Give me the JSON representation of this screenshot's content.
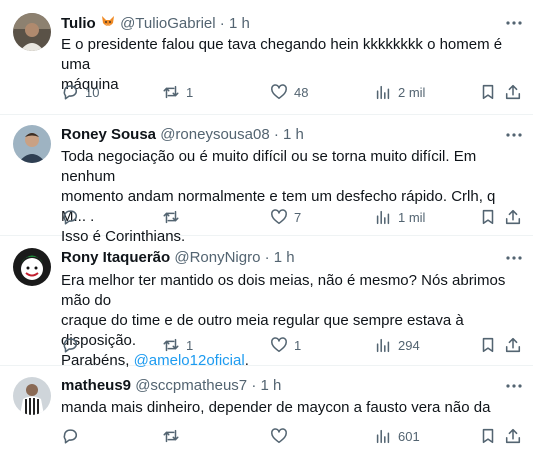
{
  "colors": {
    "text": "#0f1419",
    "secondary": "#536471",
    "accent": "#1d9bf0",
    "divider": "#eff3f4"
  },
  "tweets": [
    {
      "name": "Tulio",
      "handle": "@TulioGabriel",
      "time": "1 h",
      "text_lines": [
        "E o presidente falou que tava chegando hein kkkkkkkk o homem é uma",
        "máquina"
      ],
      "replies": "10",
      "reposts": "1",
      "likes": "48",
      "views": "2 mil"
    },
    {
      "name": "Roney Sousa",
      "handle": "@roneysousa08",
      "time": "1 h",
      "text_lines": [
        "Toda negociação ou é muito difícil ou se torna muito difícil. Em nenhum",
        "momento andam normalmente e tem um desfecho rápido. Crlh, q M... .",
        "Isso é Corinthians."
      ],
      "replies": "",
      "reposts": "",
      "likes": "7",
      "views": "1 mil"
    },
    {
      "name": "Rony Itaquerão",
      "handle": "@RonyNigro",
      "time": "1 h",
      "text_lines": [
        "Era melhor ter mantido os dois meias, não é mesmo? Nós abrimos mão do",
        "craque do time e de outro meia regular que sempre estava à disposição.",
        "Parabéns,"
      ],
      "mention": "@amelo12oficial",
      "mention_suffix": ".",
      "replies": "",
      "reposts": "1",
      "likes": "1",
      "views": "294"
    },
    {
      "name": "matheus9",
      "handle": "@sccpmatheus7",
      "time": "1 h",
      "text_lines": [
        "manda mais dinheiro, depender de maycon a fausto vera não da"
      ],
      "replies": "",
      "reposts": "",
      "likes": "",
      "views": "601"
    }
  ],
  "separator": "·",
  "icons": [
    "more-icon",
    "reply-icon",
    "repost-icon",
    "like-icon",
    "views-icon",
    "bookmark-icon",
    "share-icon"
  ]
}
